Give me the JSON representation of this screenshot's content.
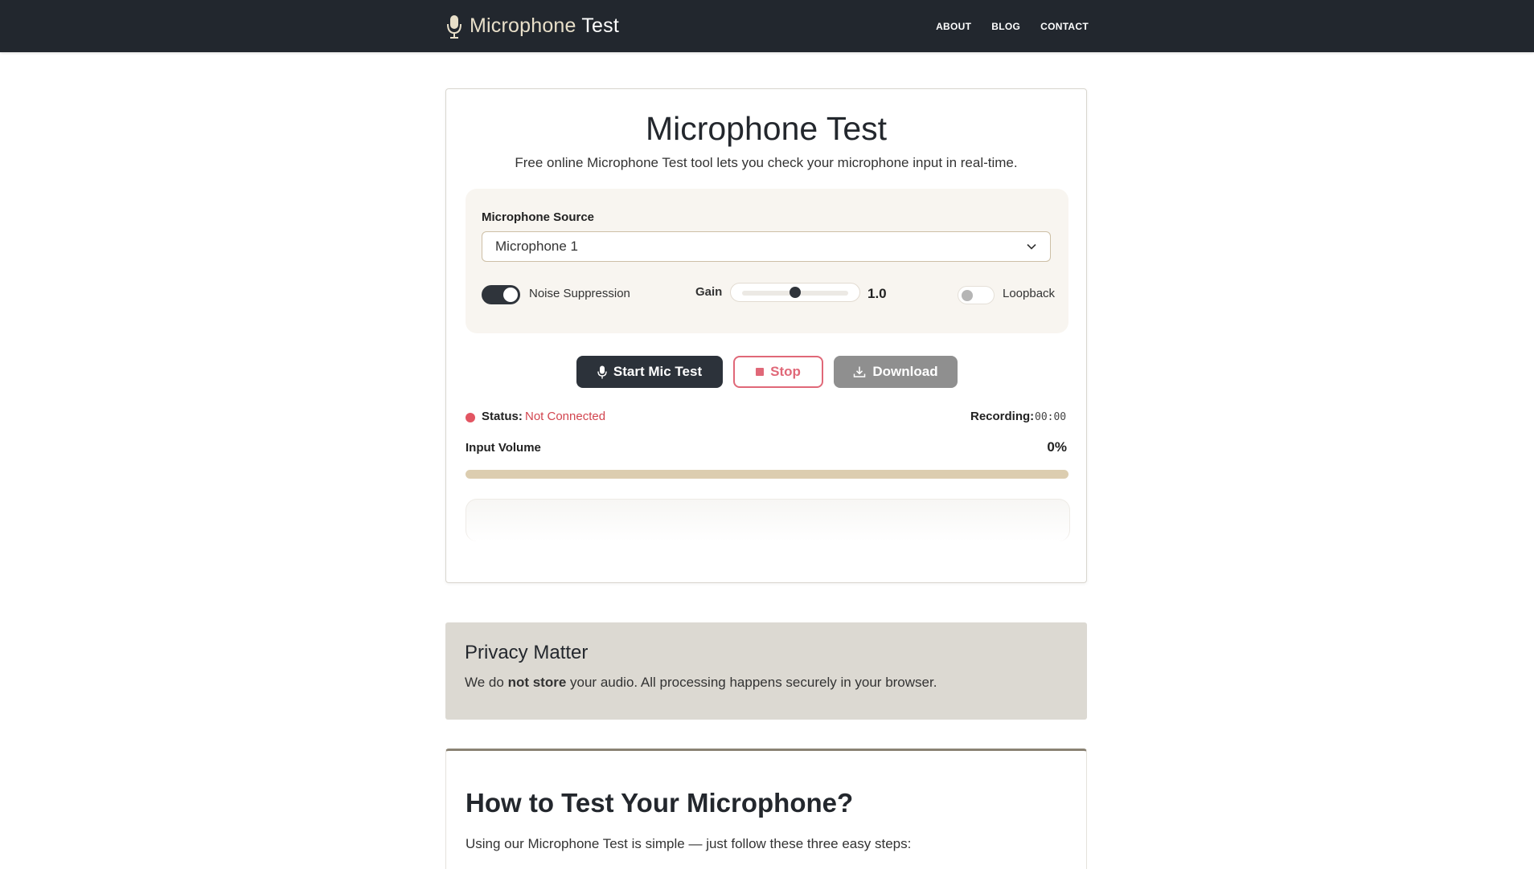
{
  "nav": {
    "brand_part1": "Microphone",
    "brand_part2": " Test",
    "links": [
      "ABOUT",
      "BLOG",
      "CONTACT"
    ]
  },
  "tool": {
    "title": "Microphone Test",
    "subtitle": "Free online Microphone Test tool lets you check your microphone input in real-time.",
    "source_label": "Microphone Source",
    "source_value": "Microphone 1",
    "noise_suppression_label": "Noise Suppression",
    "noise_suppression_on": true,
    "gain_label": "Gain",
    "gain_value": "1.0",
    "gain_fraction": 0.5,
    "loopback_label": "Loopback",
    "loopback_on": false,
    "buttons": {
      "start": "Start Mic Test",
      "stop": "Stop",
      "download": "Download"
    },
    "status_label": "Status:",
    "status_value": "Not Connected",
    "recording_label": "Recording:",
    "recording_value": "00:00",
    "volume_label": "Input Volume",
    "volume_value": "0%",
    "volume_fraction": 0
  },
  "privacy": {
    "title": "Privacy Matter",
    "text_before": "We do ",
    "text_bold": "not store",
    "text_after": " your audio. All processing happens securely in your browser."
  },
  "howto": {
    "title": "How to Test Your Microphone?",
    "text": "Using our Microphone Test is simple — just follow these three easy steps:"
  },
  "colors": {
    "navbar": "#22272e",
    "accent_dark": "#2c323a",
    "stop_red": "#e06878",
    "status_red": "#d2454f",
    "volume_track": "#dccdb0"
  }
}
